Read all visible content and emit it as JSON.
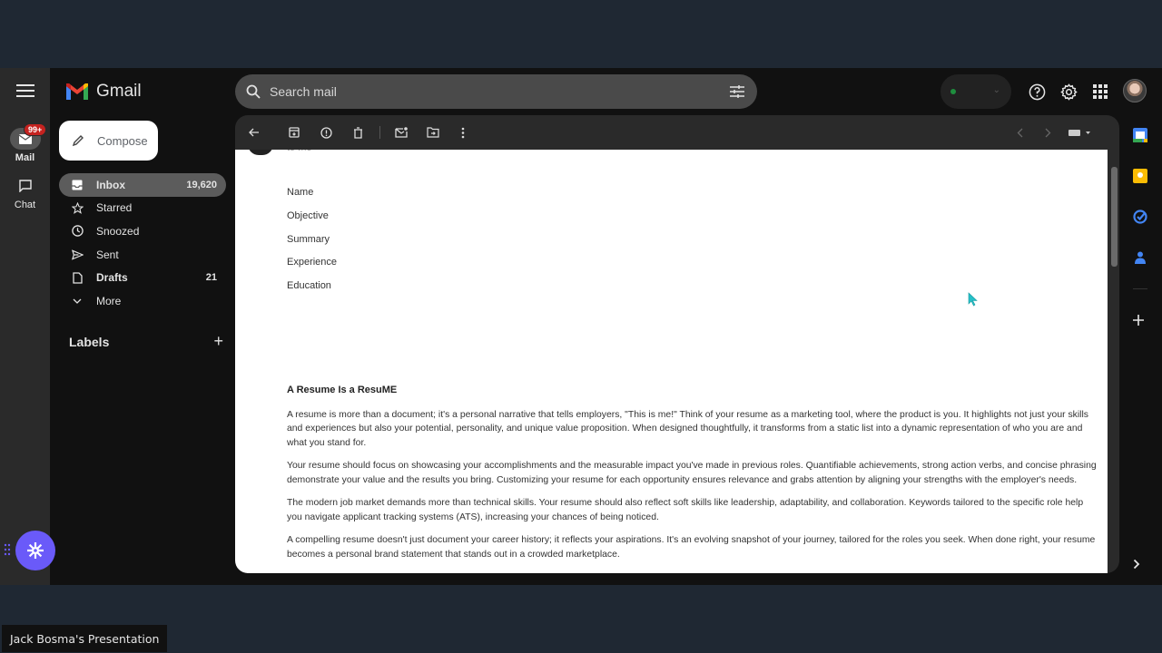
{
  "app": {
    "name": "Gmail"
  },
  "rail": {
    "items": [
      {
        "label": "Mail",
        "badge": "99+",
        "icon": "mail-icon",
        "active": true
      },
      {
        "label": "Chat",
        "icon": "chat-icon",
        "active": false
      }
    ]
  },
  "compose": {
    "label": "Compose"
  },
  "nav": {
    "items": [
      {
        "label": "Inbox",
        "count": "19,620",
        "icon": "inbox-icon",
        "active": true
      },
      {
        "label": "Starred",
        "count": "",
        "icon": "star-icon"
      },
      {
        "label": "Snoozed",
        "count": "",
        "icon": "clock-icon"
      },
      {
        "label": "Sent",
        "count": "",
        "icon": "send-icon"
      },
      {
        "label": "Drafts",
        "count": "21",
        "icon": "draft-icon"
      },
      {
        "label": "More",
        "count": "",
        "icon": "chevron-down-icon"
      }
    ]
  },
  "labels": {
    "title": "Labels",
    "add": "+"
  },
  "search": {
    "placeholder": "Search mail",
    "value": ""
  },
  "status": {
    "color": "#1e8e3e"
  },
  "email": {
    "recipient_line": "to me",
    "sections": [
      "Name",
      "Objective",
      "Summary",
      "Experience",
      "Education"
    ],
    "title": "A Resume Is a ResuME",
    "paragraphs": [
      "A resume is more than a document; it's a personal narrative that tells employers, \"This is me!\" Think of your resume as a marketing tool, where the product is you. It highlights not just your skills and experiences but also your potential, personality, and unique value proposition. When designed thoughtfully, it transforms from a static list into a dynamic representation of who you are and what you stand for.",
      "Your resume should focus on showcasing your accomplishments and the measurable impact you've made in previous roles. Quantifiable achievements, strong action verbs, and concise phrasing demonstrate your value and the results you bring. Customizing your resume for each opportunity ensures relevance and grabs attention by aligning your strengths with the employer's needs.",
      "The modern job market demands more than technical skills. Your resume should also reflect soft skills like leadership, adaptability, and collaboration. Keywords tailored to the specific role help you navigate applicant tracking systems (ATS), increasing your chances of being noticed.",
      "A compelling resume doesn't just document your career history; it reflects your aspirations. It's an evolving snapshot of your journey, tailored for the roles you seek. When done right, your resume becomes a personal brand statement that stands out in a crowded marketplace."
    ]
  },
  "presenter": {
    "label": "Jack Bosma's Presentation"
  },
  "colors": {
    "accent_assist": "#6a5af9",
    "badge": "#c5221f"
  }
}
